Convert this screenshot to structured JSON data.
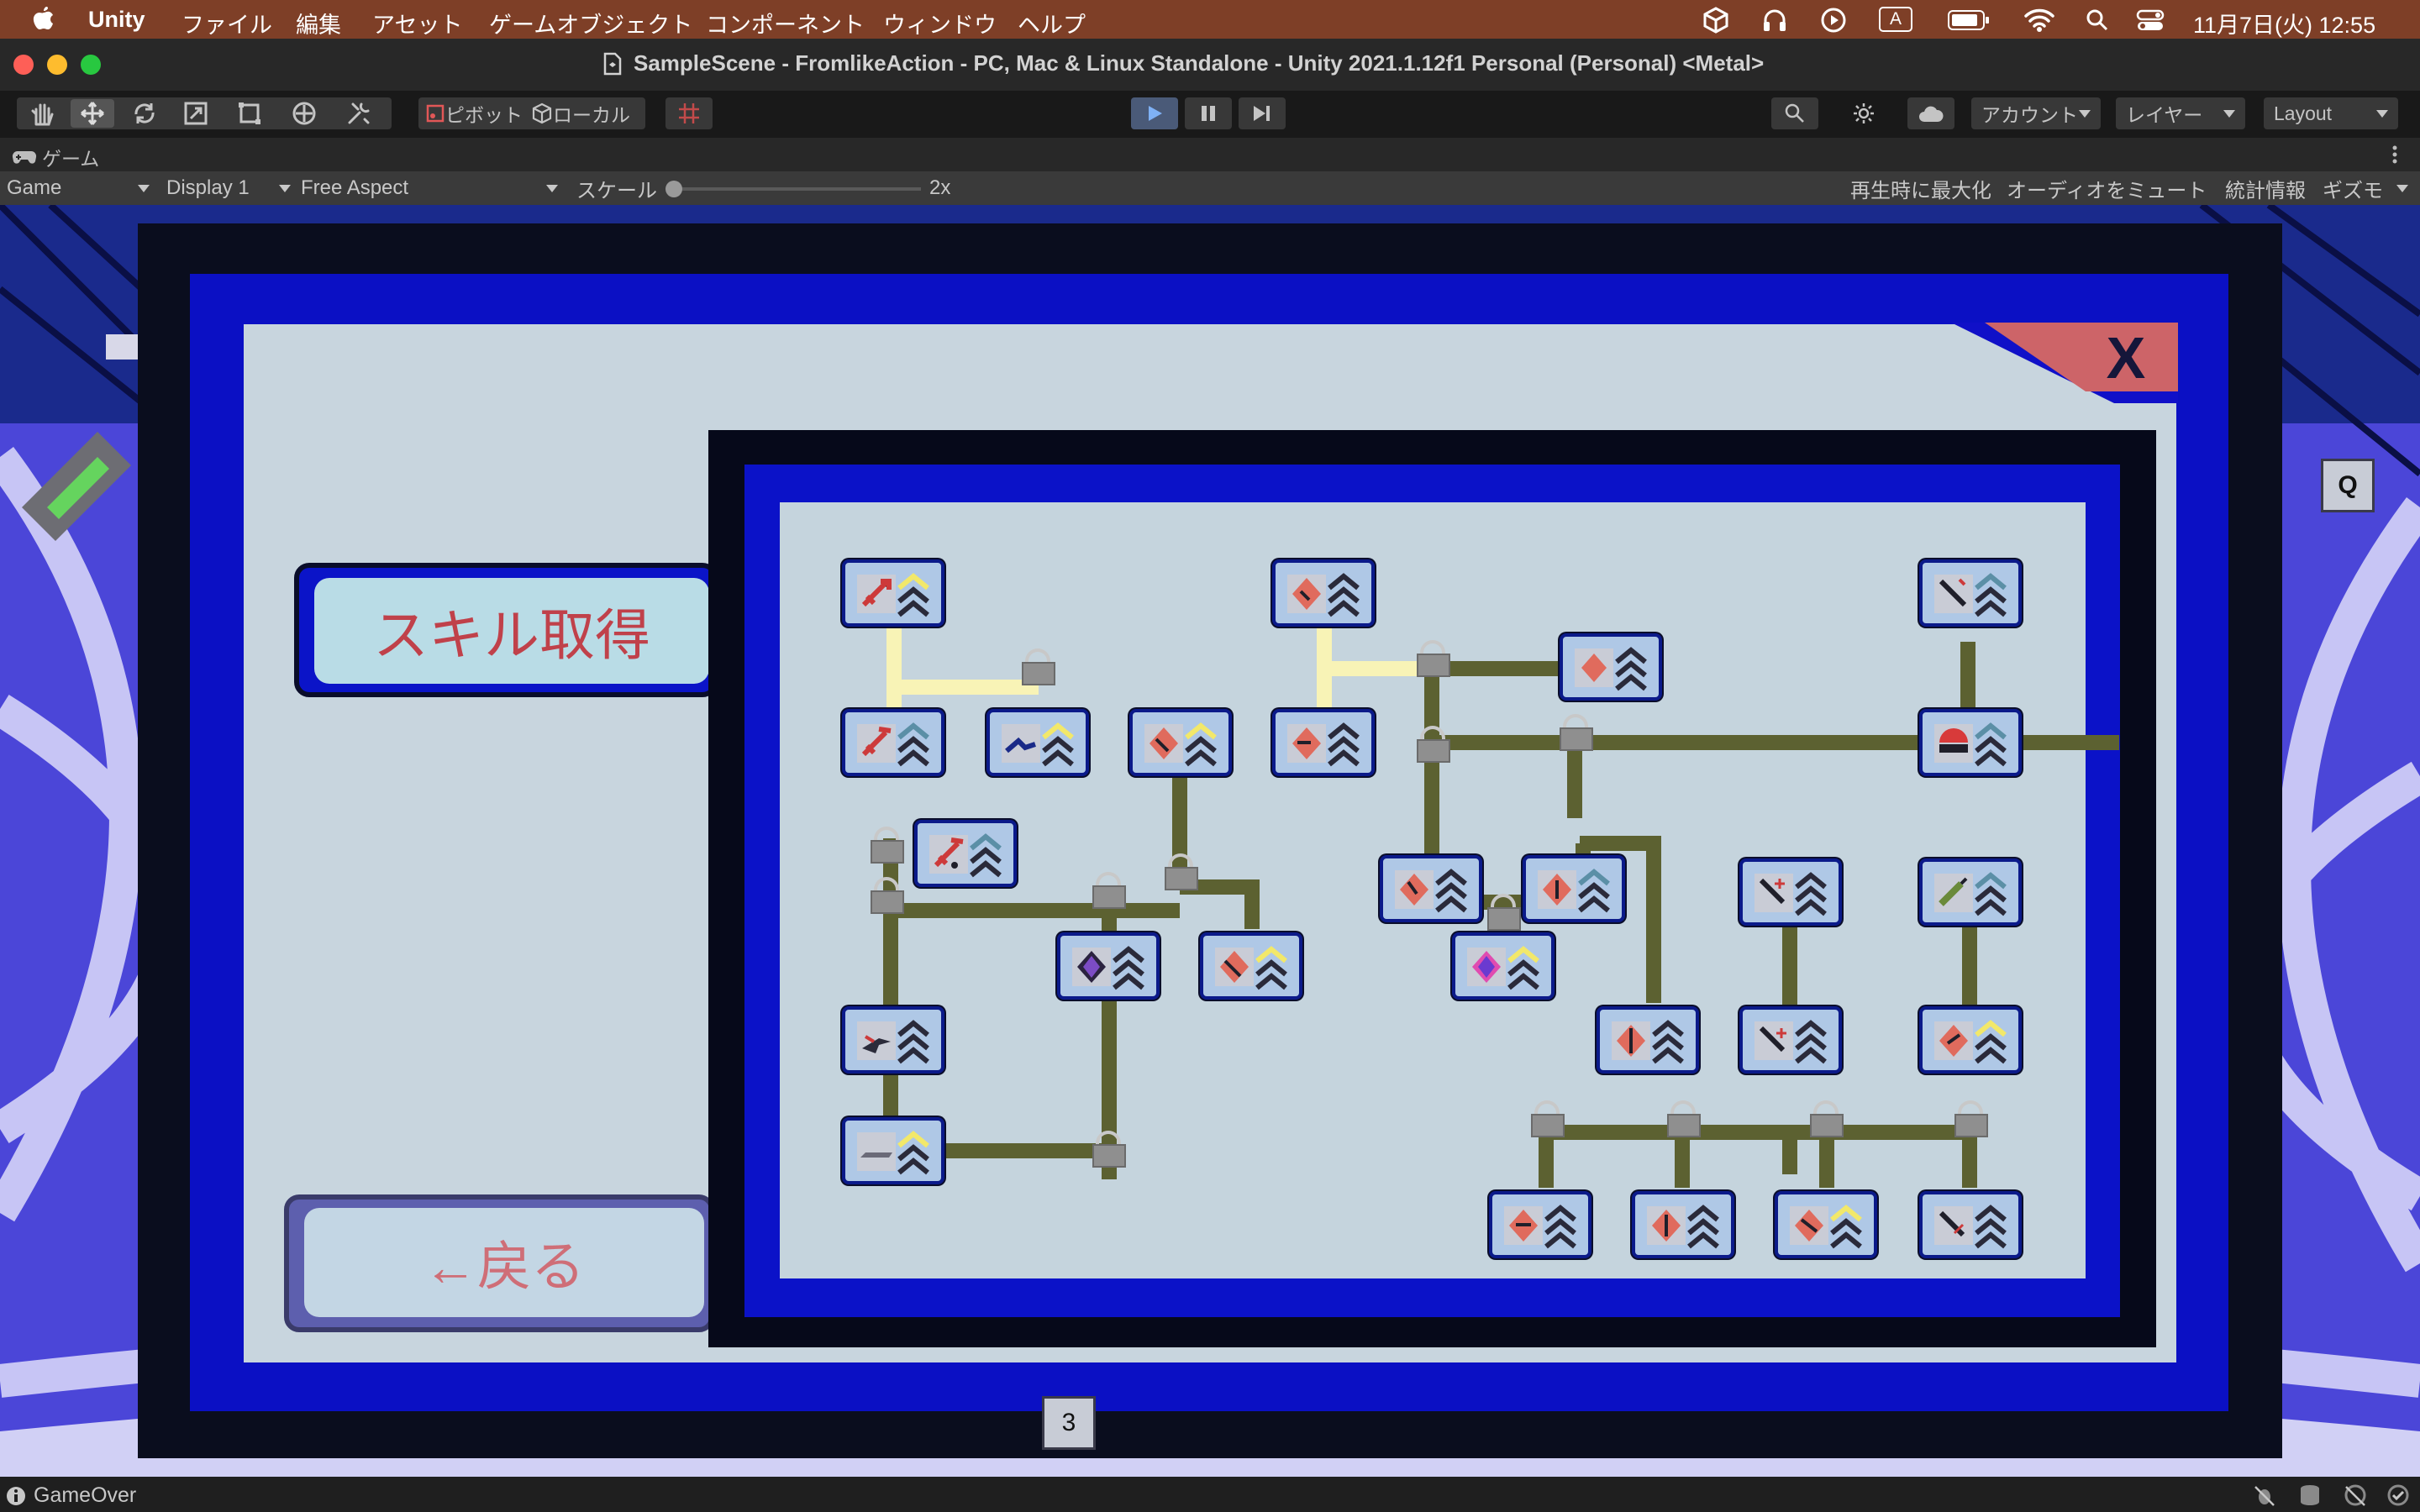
{
  "menubar": {
    "app": "Unity",
    "items": [
      "ファイル",
      "編集",
      "アセット",
      "ゲームオブジェクト",
      "コンポーネント",
      "ウィンドウ",
      "ヘルプ"
    ],
    "input_indicator": "A",
    "datetime": "11月7日(火)  12:55"
  },
  "window": {
    "title": "SampleScene - FromlikeAction - PC, Mac & Linux Standalone - Unity 2021.1.12f1 Personal (Personal) <Metal>"
  },
  "toolbar": {
    "pivot": "ピボット",
    "local": "ローカル",
    "account": "アカウント",
    "layers": "レイヤー",
    "layout": "Layout"
  },
  "tab": {
    "label": "ゲーム"
  },
  "gamebar": {
    "view": "Game",
    "display": "Display 1",
    "aspect": "Free Aspect",
    "scale_label": "スケール",
    "scale_value": "2x",
    "maximize": "再生時に最大化",
    "mute": "オーディオをミュート",
    "stats": "統計情報",
    "gizmos": "ギズモ"
  },
  "game": {
    "skill_button": "スキル取得",
    "back_button": "←戻る",
    "close_glyph": "X",
    "q_key": "Q",
    "slot_number": "3"
  },
  "status": {
    "message": "GameOver"
  },
  "colors": {
    "menubar": "#7e3f27",
    "panel_blue": "#0b10c4",
    "panel_light": "#c8d5de",
    "connector": "#5c6131",
    "unlocked_path": "#f5f0b5",
    "button_text": "#c0414a",
    "close_tab": "#cd6468"
  }
}
